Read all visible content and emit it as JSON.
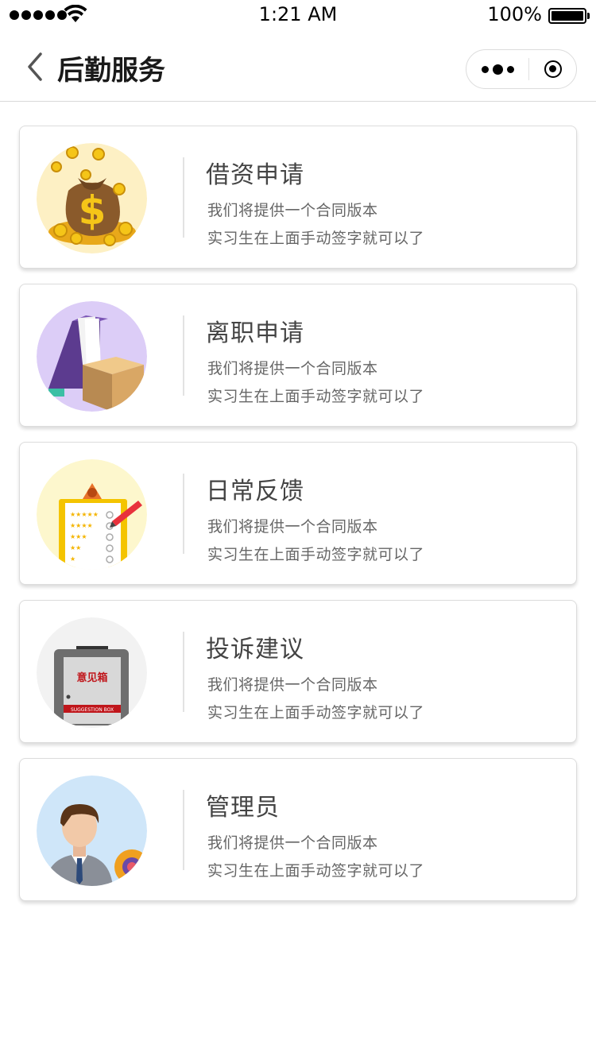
{
  "status_bar": {
    "time": "1:21 AM",
    "battery_pct": "100%"
  },
  "nav": {
    "title": "后勤服务"
  },
  "items": [
    {
      "title": "借资申请",
      "desc_line1": "我们将提供一个合同版本",
      "desc_line2": "实习生在上面手动签字就可以了",
      "icon": "money-bag-icon",
      "bg": "#fdf0c4"
    },
    {
      "title": "离职申请",
      "desc_line1": "我们将提供一个合同版本",
      "desc_line2": "实习生在上面手动签字就可以了",
      "icon": "file-box-icon",
      "bg": "#dccdf7"
    },
    {
      "title": "日常反馈",
      "desc_line1": "我们将提供一个合同版本",
      "desc_line2": "实习生在上面手动签字就可以了",
      "icon": "feedback-form-icon",
      "bg": "#fdf7cd"
    },
    {
      "title": "投诉建议",
      "desc_line1": "我们将提供一个合同版本",
      "desc_line2": "实习生在上面手动签字就可以了",
      "icon": "suggestion-box-icon",
      "bg": "#f2f2f2",
      "box_label": "意见箱",
      "box_banner": "SUGGESTION BOX"
    },
    {
      "title": "管理员",
      "desc_line1": "我们将提供一个合同版本",
      "desc_line2": "实习生在上面手动签字就可以了",
      "icon": "admin-icon",
      "bg": "#cfe6f9"
    }
  ]
}
